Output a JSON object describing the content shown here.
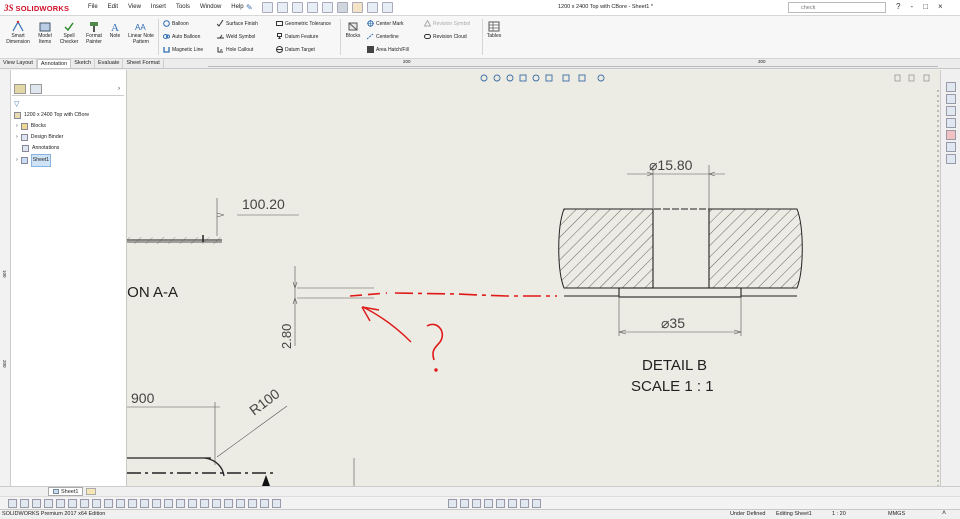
{
  "app": {
    "logo_ds": "3S",
    "logo_name": "SOLIDWORKS"
  },
  "menu": [
    "File",
    "Edit",
    "View",
    "Insert",
    "Tools",
    "Window",
    "Help"
  ],
  "document_title": "1200 x 2400 Top with CBore - Sheet1 *",
  "search": {
    "placeholder": "check"
  },
  "window_controls": [
    "?",
    "-",
    "□",
    "×"
  ],
  "ribbon": {
    "smart_dimension": "Smart Dimension",
    "model_items": "Model Items",
    "spell_checker": "Spell Checker",
    "format_painter": "Format Painter",
    "note": "Note",
    "linear_note_pattern": "Linear Note Pattern",
    "balloon": "Balloon",
    "auto_balloon": "Auto Balloon",
    "magnetic_line": "Magnetic Line",
    "surface_finish": "Surface Finish",
    "weld_symbol": "Weld Symbol",
    "hole_callout": "Hole Callout",
    "geometric_tolerance": "Geometric Tolerance",
    "datum_feature": "Datum Feature",
    "datum_target": "Datum Target",
    "blocks": "Blocks",
    "center_mark": "Center Mark",
    "centerline": "Centerline",
    "area_hatch": "Area Hatch/Fill",
    "revision_symbol": "Revision Symbol",
    "revision_cloud": "Revision Cloud",
    "tables": "Tables"
  },
  "tabs": [
    "View Layout",
    "Annotation",
    "Sketch",
    "Evaluate",
    "Sheet Format"
  ],
  "active_tab": "Annotation",
  "ruler_marks": {
    "top_a": "200",
    "top_b": "300",
    "left_a": "100",
    "left_b": "200"
  },
  "tree": {
    "root": "1200 x 2400 Top with CBore",
    "items": [
      "Blocks",
      "Design Binder",
      "Annotations",
      "Sheet1"
    ]
  },
  "drawing": {
    "dim_100_20": "100.20",
    "section_label": "ION A-A",
    "dim_2_80": "2.80",
    "dim_900": "900",
    "dim_r100": "R100",
    "dim_dia_15_80": "⌀15.80",
    "dim_dia_35": "⌀35",
    "detail_label": "DETAIL B",
    "scale_label": "SCALE 1 : 1",
    "question_mark": "?"
  },
  "sheet_tab": "Sheet1",
  "status": {
    "edition": "SOLIDWORKS Premium 2017 x64 Edition",
    "defined": "Under Defined",
    "editing": "Editing Sheet1",
    "scale": "1 : 20",
    "units": "MMGS"
  },
  "colors": {
    "brand": "#d0102a",
    "canvas": "#ecebe4",
    "annotation_red": "#e01818"
  }
}
